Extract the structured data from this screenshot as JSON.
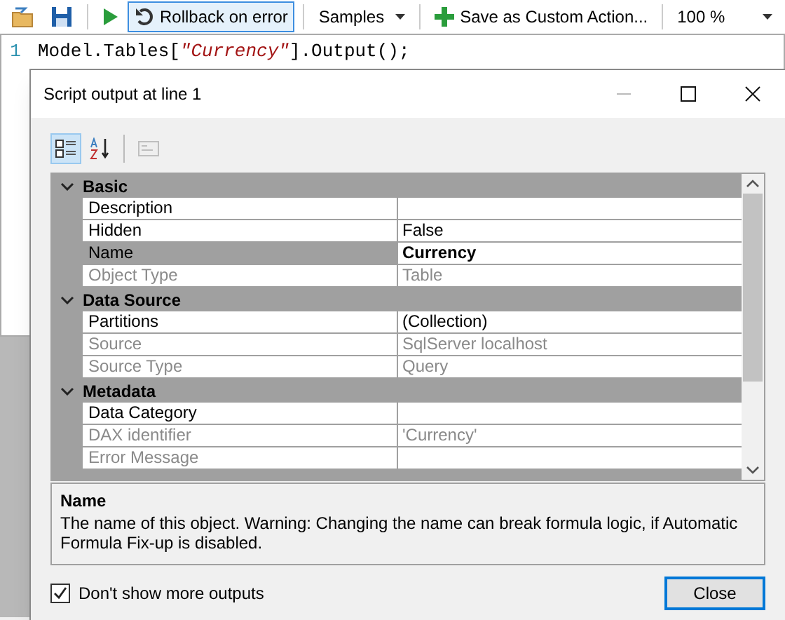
{
  "toolbar": {
    "items": [
      {
        "kind": "open"
      },
      {
        "kind": "save"
      },
      {
        "kind": "divider"
      },
      {
        "kind": "run"
      },
      {
        "kind": "toggle",
        "label": "Rollback on error",
        "selected": true
      },
      {
        "kind": "divider"
      },
      {
        "kind": "dropdown",
        "label": "Samples"
      },
      {
        "kind": "divider"
      },
      {
        "kind": "action",
        "label": "Save as Custom Action..."
      },
      {
        "kind": "divider"
      },
      {
        "kind": "combo",
        "label": "100 %"
      }
    ]
  },
  "editor": {
    "line_number": "1",
    "tokens": [
      {
        "kind": "plain",
        "text": "Model.Tables["
      },
      {
        "kind": "string",
        "text": "\"Currency\""
      },
      {
        "kind": "plain",
        "text": "].Output();"
      }
    ]
  },
  "dialog": {
    "title": "Script output at line 1",
    "grid_toolbar": [
      {
        "kind": "categorized",
        "selected": true,
        "disabled": false
      },
      {
        "kind": "alphabetical",
        "selected": false,
        "disabled": false
      },
      {
        "kind": "pages",
        "selected": false,
        "disabled": true
      }
    ],
    "categories": [
      {
        "name": "Basic",
        "expanded": true,
        "properties": [
          {
            "name": "Description",
            "disabled": false,
            "selected": false
          },
          {
            "name": "Hidden",
            "value": "False",
            "disabled": false,
            "selected": false
          },
          {
            "name": "Name",
            "value": "Currency",
            "disabled": false,
            "selected": true
          },
          {
            "name": "Object Type",
            "value": "Table",
            "disabled": true,
            "selected": false
          }
        ]
      },
      {
        "name": "Data Source",
        "expanded": true,
        "properties": [
          {
            "name": "Partitions",
            "value": "(Collection)",
            "disabled": false,
            "selected": false
          },
          {
            "name": "Source",
            "value": "SqlServer localhost",
            "disabled": true,
            "selected": false
          },
          {
            "name": "Source Type",
            "value": "Query",
            "disabled": true,
            "selected": false
          }
        ]
      },
      {
        "name": "Metadata",
        "expanded": true,
        "properties": [
          {
            "name": "Data Category",
            "disabled": false,
            "selected": false
          },
          {
            "name": "DAX identifier",
            "value": "'Currency'",
            "disabled": true,
            "selected": false
          },
          {
            "name": "Error Message",
            "disabled": true,
            "selected": false
          }
        ]
      },
      {
        "expanded": true
      }
    ],
    "description": {
      "title": "Name",
      "text": "The name of this object. Warning: Changing the name can break formula logic, if Automatic Formula Fix-up is disabled."
    },
    "checkbox": {
      "label": "Don't show more outputs",
      "checked": true
    },
    "close_button": "Close"
  }
}
